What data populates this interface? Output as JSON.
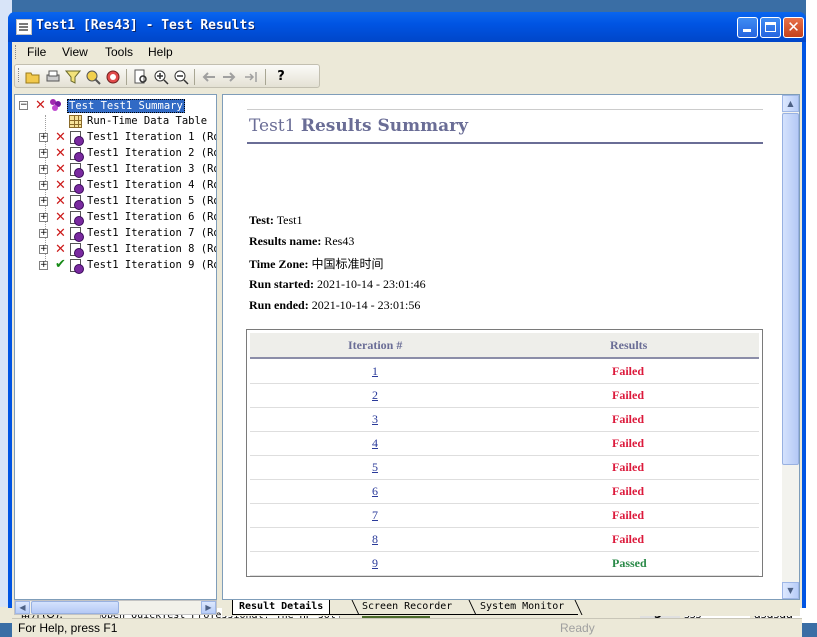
{
  "window": {
    "title": "Test1 [Res43] - Test Results"
  },
  "menu": [
    {
      "label": "File",
      "accel": "F"
    },
    {
      "label": "View",
      "accel": "V"
    },
    {
      "label": "Tools",
      "accel": "T"
    },
    {
      "label": "Help",
      "accel": "H"
    }
  ],
  "toolbar": {
    "icons": [
      "open-icon",
      "print-icon",
      "filter-icon",
      "find-icon",
      "zoom-results-icon",
      "preview-icon",
      "zoom-in-icon",
      "zoom-out-icon",
      "back-icon",
      "forward-icon",
      "jump-icon",
      "help-icon"
    ]
  },
  "tree": {
    "root_label": "Test Test1 Summary",
    "data_table_label": "Run-Time Data Table",
    "iterations": [
      {
        "label": "Test1 Iteration 1 (Ro",
        "status": "failed"
      },
      {
        "label": "Test1 Iteration 2 (Ro",
        "status": "failed"
      },
      {
        "label": "Test1 Iteration 3 (Ro",
        "status": "failed"
      },
      {
        "label": "Test1 Iteration 4 (Ro",
        "status": "failed"
      },
      {
        "label": "Test1 Iteration 5 (Ro",
        "status": "failed"
      },
      {
        "label": "Test1 Iteration 6 (Ro",
        "status": "failed"
      },
      {
        "label": "Test1 Iteration 7 (Ro",
        "status": "failed"
      },
      {
        "label": "Test1 Iteration 8 (Ro",
        "status": "failed"
      },
      {
        "label": "Test1 Iteration 9 (Ro",
        "status": "passed"
      }
    ]
  },
  "summary": {
    "title_plain": "Test1 ",
    "title_bold": "Results Summary",
    "test_label": "Test:",
    "test_value": "Test1",
    "results_name_label": "Results name:",
    "results_name_value": "Res43",
    "timezone_label": "Time Zone:",
    "timezone_value": "中国标准时间",
    "run_started_label": "Run started:",
    "run_started_value": "2021-10-14 - 23:01:46",
    "run_ended_label": "Run ended:",
    "run_ended_value": "2021-10-14 - 23:01:56",
    "table": {
      "headers": [
        "Iteration #",
        "Results"
      ],
      "rows": [
        {
          "iteration": "1",
          "result": "Failed"
        },
        {
          "iteration": "2",
          "result": "Failed"
        },
        {
          "iteration": "3",
          "result": "Failed"
        },
        {
          "iteration": "4",
          "result": "Failed"
        },
        {
          "iteration": "5",
          "result": "Failed"
        },
        {
          "iteration": "6",
          "result": "Failed"
        },
        {
          "iteration": "7",
          "result": "Failed"
        },
        {
          "iteration": "8",
          "result": "Failed"
        },
        {
          "iteration": "9",
          "result": "Passed"
        }
      ]
    }
  },
  "tabs": [
    "Result Details",
    "Screen Recorder",
    "System Monitor"
  ],
  "status": {
    "left": "For Help, press F1",
    "right": "Ready"
  },
  "background": {
    "bottom_left": "备注(O):",
    "bottom_mid": "Open QuickTest Professional! The HP sol",
    "bottom_num": "5",
    "bottom_sss": "sss",
    "bottom_asd": "asdsda"
  },
  "colors": {
    "failed": "#dc1a3c",
    "passed": "#2a8a48",
    "title_accent": "#6a6d96"
  }
}
